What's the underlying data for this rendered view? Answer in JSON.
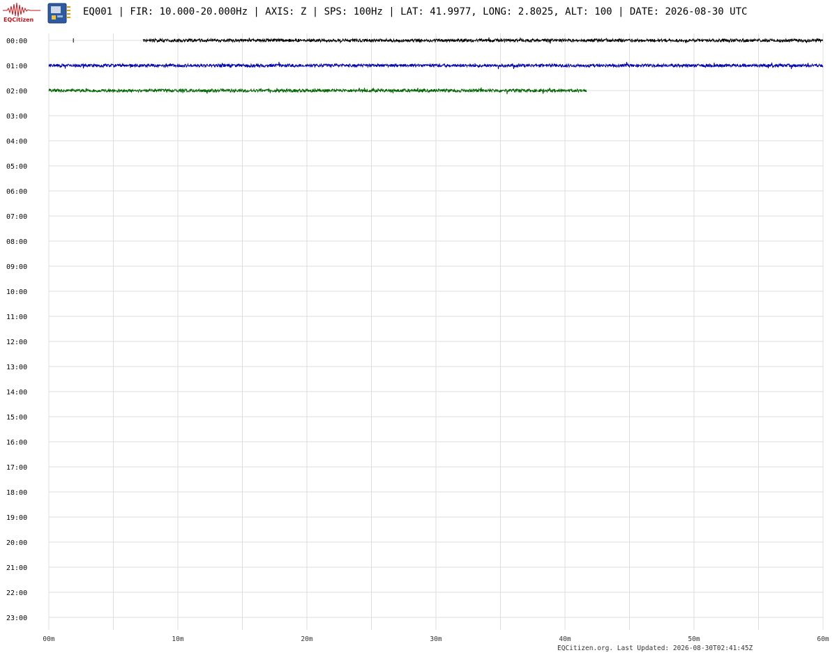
{
  "header": {
    "logo_text": "EQCitizen",
    "title": "EQ001 | FIR: 10.000-20.000Hz | AXIS: Z | SPS: 100Hz | LAT: 41.9977, LONG: 2.8025, ALT: 100 | DATE: 2026-08-30 UTC"
  },
  "footer": {
    "text": "EQCitizen.org. Last Updated: 2026-08-30T02:41:45Z"
  },
  "colors": {
    "row_colors": [
      "#000000",
      "#0000aa",
      "#006400"
    ],
    "grid": "#dddddd",
    "logo_red": "#c0141c"
  },
  "icons": [
    "eqcitizen-logo-icon",
    "seismometer-device-icon"
  ],
  "chart_data": {
    "type": "line",
    "subtype": "helicorder",
    "y_tick_labels": [
      "00:00",
      "01:00",
      "02:00",
      "03:00",
      "04:00",
      "05:00",
      "06:00",
      "07:00",
      "08:00",
      "09:00",
      "10:00",
      "11:00",
      "12:00",
      "13:00",
      "14:00",
      "15:00",
      "16:00",
      "17:00",
      "18:00",
      "19:00",
      "20:00",
      "21:00",
      "22:00",
      "23:00"
    ],
    "x_tick_labels": [
      "00m",
      "10m",
      "20m",
      "30m",
      "40m",
      "50m",
      "60m"
    ],
    "xlim": [
      0,
      60
    ],
    "grid": true,
    "series": [
      {
        "row": "00:00",
        "segments": [
          [
            1.9,
            2.0
          ],
          [
            7.3,
            60
          ]
        ]
      },
      {
        "row": "01:00",
        "segments": [
          [
            0,
            60
          ]
        ]
      },
      {
        "row": "02:00",
        "segments": [
          [
            0,
            41.7
          ]
        ]
      }
    ]
  }
}
